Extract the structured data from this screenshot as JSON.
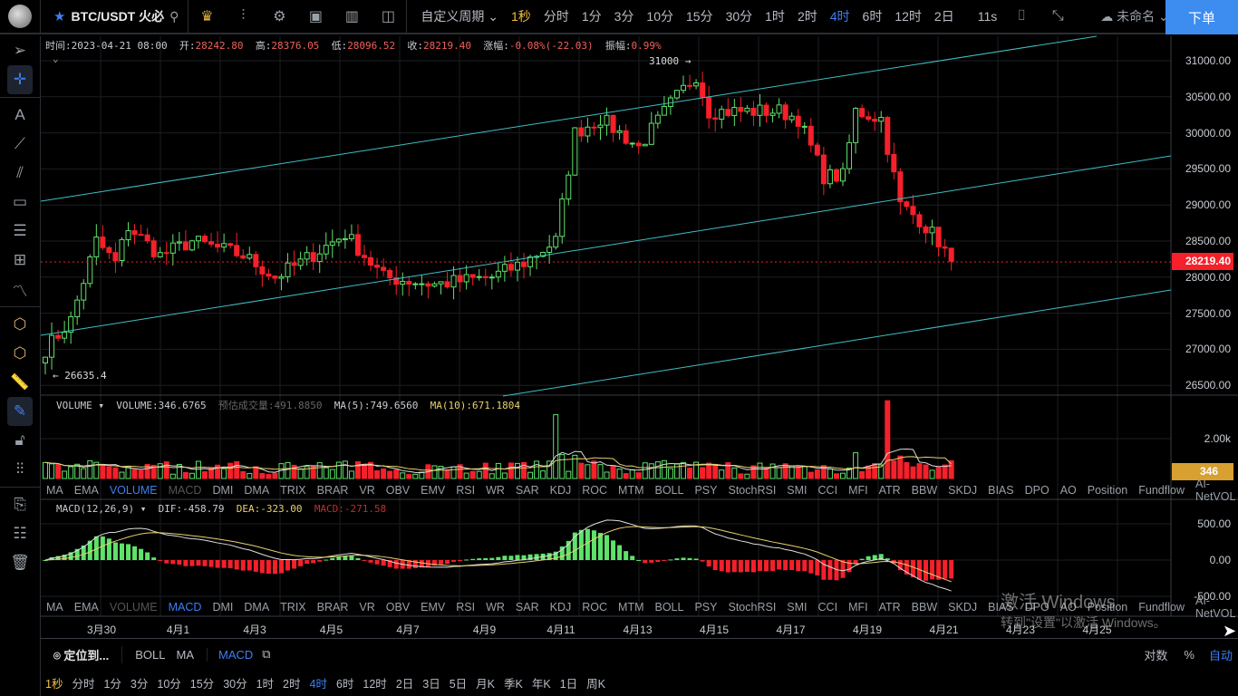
{
  "header": {
    "symbol": "BTC/USDT 火必",
    "custom_period": "自定义周期",
    "periods": [
      "1秒",
      "分时",
      "1分",
      "3分",
      "10分",
      "15分",
      "30分",
      "1时",
      "2时",
      "4时",
      "6时",
      "12时",
      "2日"
    ],
    "active_period": "4时",
    "countdown": "11s",
    "layout_name": "未命名",
    "order_button": "下单"
  },
  "ohlc": {
    "time_label": "时间:",
    "time": "2023-04-21 08:00",
    "open_label": "开:",
    "open": "28242.80",
    "high_label": "高:",
    "high": "28376.05",
    "low_label": "低:",
    "low": "28096.52",
    "close_label": "收:",
    "close": "28219.40",
    "change_label": "涨幅:",
    "change": "-0.08%(-22.03)",
    "amp_label": "振幅:",
    "amp": "0.99%"
  },
  "price_axis": [
    "31000.00",
    "30500.00",
    "30000.00",
    "29500.00",
    "29000.00",
    "28500.00",
    "28000.00",
    "27500.00",
    "27000.00",
    "26500.00"
  ],
  "last_price": "28219.40",
  "max_marker": "31000",
  "min_marker": "26635.4",
  "volume": {
    "title": "VOLUME",
    "value": "VOLUME:346.6765",
    "est": "预估成交量:491.8850",
    "ma5": "MA(5):749.6560",
    "ma10": "MA(10):671.1804",
    "axis": "2.00k",
    "last": "346"
  },
  "macd": {
    "title": "MACD(12,26,9)",
    "dif": "DIF:-458.79",
    "dea": "DEA:-323.00",
    "macd": "MACD:-271.58",
    "axis": [
      "500.00",
      "0.00",
      "-500.00"
    ]
  },
  "indicator_tabs": [
    "MA",
    "EMA",
    "VOLUME",
    "MACD",
    "DMI",
    "DMA",
    "TRIX",
    "BRAR",
    "VR",
    "OBV",
    "EMV",
    "RSI",
    "WR",
    "SAR",
    "KDJ",
    "ROC",
    "MTM",
    "BOLL",
    "PSY",
    "StochRSI",
    "SMI",
    "CCI",
    "MFI",
    "ATR",
    "BBW",
    "SKDJ",
    "BIAS",
    "DPO",
    "AO",
    "Position",
    "Fundflow",
    "AI-NetVOL"
  ],
  "dates": [
    "3月30",
    "4月1",
    "4月3",
    "4月5",
    "4月7",
    "4月9",
    "4月11",
    "4月13",
    "4月15",
    "4月17",
    "4月19",
    "4月21",
    "4月23",
    "4月25"
  ],
  "bottom": {
    "locate": "定位到...",
    "studies": [
      "BOLL",
      "MA"
    ],
    "active_study": "MACD",
    "scale": [
      "对数",
      "%",
      "自动"
    ],
    "periods": [
      "1秒",
      "分时",
      "1分",
      "3分",
      "10分",
      "15分",
      "30分",
      "1时",
      "2时",
      "4时",
      "6时",
      "12时",
      "2日",
      "3日",
      "5日",
      "月K",
      "季K",
      "年K",
      "1日",
      "周K"
    ]
  },
  "watermark": {
    "line1": "激活 Windows",
    "line2": "转到\"设置\"以激活 Windows。"
  },
  "colors": {
    "up": "#5ee36a",
    "down": "#f5202a",
    "accent": "#3d7ff0",
    "channel": "#3fbfc4"
  },
  "chart_data": {
    "type": "candlestick",
    "interval": "4h",
    "price_range": [
      26500,
      31200
    ],
    "close_path": [
      [
        0,
        27000
      ],
      [
        4,
        27400
      ],
      [
        8,
        28500
      ],
      [
        11,
        28200
      ],
      [
        13,
        28700
      ],
      [
        18,
        28300
      ],
      [
        23,
        28500
      ],
      [
        31,
        28300
      ],
      [
        36,
        28000
      ],
      [
        40,
        28200
      ],
      [
        47,
        28600
      ],
      [
        53,
        28000
      ],
      [
        61,
        27900
      ],
      [
        70,
        28000
      ],
      [
        75,
        28200
      ],
      [
        80,
        28500
      ],
      [
        83,
        30000
      ],
      [
        87,
        30200
      ],
      [
        93,
        29800
      ],
      [
        98,
        30400
      ],
      [
        102,
        30800
      ],
      [
        104,
        30300
      ],
      [
        115,
        30300
      ],
      [
        118,
        30200
      ],
      [
        122,
        29400
      ],
      [
        125,
        29400
      ],
      [
        127,
        30300
      ],
      [
        131,
        30200
      ],
      [
        134,
        29000
      ],
      [
        137,
        28800
      ],
      [
        140,
        28500
      ],
      [
        142,
        28220
      ]
    ]
  }
}
